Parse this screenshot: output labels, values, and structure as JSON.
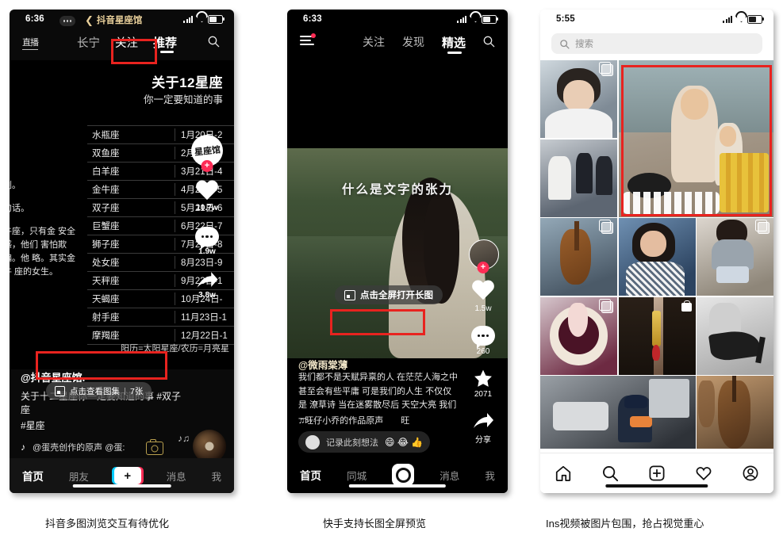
{
  "captions": {
    "phone1": "抖音多图浏览交互有待优化",
    "phone2": "快手支持长图全屏预览",
    "phone3": "Ins视频被图片包围，抢占视觉重心"
  },
  "phone1": {
    "app": "抖音",
    "status": {
      "time": "6:36"
    },
    "nav_title": "抖音星座馆",
    "back_chevron": "❮",
    "tabs": {
      "live": "直播",
      "items": [
        "长宁",
        "关注",
        "推荐"
      ],
      "active": "推荐",
      "highlighted": "关注"
    },
    "search_icon": "search-icon",
    "poster": {
      "title": "关于12星座",
      "subtitle": "你一定要知道的事",
      "rows": [
        {
          "sign": "水瓶座",
          "dates": "1月20日-2"
        },
        {
          "sign": "双鱼座",
          "dates": "2月19日-3"
        },
        {
          "sign": "白羊座",
          "dates": "3月21日-4"
        },
        {
          "sign": "金牛座",
          "dates": "4月20日-5"
        },
        {
          "sign": "双子座",
          "dates": "5月21日-6"
        },
        {
          "sign": "巨蟹座",
          "dates": "6月22日-7"
        },
        {
          "sign": "狮子座",
          "dates": "7月23日-8"
        },
        {
          "sign": "处女座",
          "dates": "8月23日-9"
        },
        {
          "sign": "天秤座",
          "dates": "9月23日-1"
        },
        {
          "sign": "天蝎座",
          "dates": "10月24日-"
        },
        {
          "sign": "射手座",
          "dates": "11月23日-1"
        },
        {
          "sign": "摩羯座",
          "dates": "12月22日-1"
        }
      ],
      "left_text_1": "剧。",
      "left_text_2": "句话。",
      "left_text_3": "牛座，只有金 安全感，他们 害怕欺骗。他 略。其实金牛 座的女生。",
      "footnote": "阳历=太阳星座/农历=月亮星"
    },
    "rail": {
      "avatar_label": "星座馆",
      "follow_plus": "+",
      "like_count": "10.7w",
      "comment_count": "1.9w",
      "share_count": "3.8w"
    },
    "gallery_chip": {
      "label": "点击查看图集",
      "count": "7张",
      "icon": "image-stack-icon"
    },
    "caption": {
      "user": "@抖音星座馆.",
      "desc_line1": "关于十二星座你一定要知道的事 #双子座",
      "desc_line2": "#星座",
      "music_note": "♪",
      "music_text": "@蛋壳创作的原声      @蛋:"
    },
    "bottom_nav": {
      "items": [
        "首页",
        "朋友",
        "消息",
        "我"
      ],
      "active": "首页",
      "plus": "+"
    }
  },
  "phone2": {
    "app": "快手",
    "status": {
      "time": "6:33"
    },
    "menu_icon": "hamburger-icon",
    "tabs": {
      "items": [
        "关注",
        "发现",
        "精选"
      ],
      "active": "精选"
    },
    "search_icon": "search-icon",
    "video": {
      "overlay_title": "什么是文字的张力"
    },
    "chip": {
      "label": "点击全屏打开长图",
      "icon": "long-image-icon"
    },
    "author": "@微雨棠薄",
    "desc": "我们都不是天赋异禀的人 在茫茫人海之中 甚至会有些平庸 可是我们的人生 不仅仅是 潦草诗 当在迷雾散尽后 天空大亮 我们一…",
    "sound": "♫旺仔小乔的作品原声　　旺",
    "comment": {
      "placeholder": "记录此刻想法",
      "emojis": "😄 😂 👍"
    },
    "rail": {
      "follow_plus": "+",
      "like_count": "1.5w",
      "comment_count": "260",
      "star_count": "2071",
      "share_label": "分享"
    },
    "bottom_nav": {
      "items": [
        "首页",
        "同城",
        "消息",
        "我"
      ],
      "active": "首页",
      "record_icon": "record-button-icon"
    }
  },
  "phone3": {
    "app": "Instagram",
    "status": {
      "time": "5:55"
    },
    "search": {
      "placeholder": "搜索",
      "icon": "search-icon"
    },
    "grid": {
      "cells": [
        {
          "name": "portrait-young-man",
          "badge": "reels",
          "g1": "#c9d2d8",
          "g2": "#8b97a1"
        },
        {
          "name": "cooking-video-big",
          "badge": "none",
          "g1": "#c8b9a2",
          "g2": "#7d6d58",
          "big": true
        },
        {
          "name": "group-sitting",
          "badge": "none",
          "g1": "#b7bcc2",
          "g2": "#5f6671"
        },
        {
          "name": "workshop-tools",
          "badge": "reels",
          "g1": "#8fa5b5",
          "g2": "#4d5b68"
        },
        {
          "name": "smiling-woman-blue",
          "badge": "none",
          "g1": "#6f8fb0",
          "g2": "#2f4763"
        },
        {
          "name": "woman-denim-shorts",
          "badge": "reels",
          "g1": "#cfc7bf",
          "g2": "#8d8579"
        },
        {
          "name": "dessert-pour",
          "badge": "reels",
          "g1": "#d8c8cd",
          "g2": "#5d2237"
        },
        {
          "name": "gold-earring-hair",
          "badge": "bag",
          "g1": "#cbb39e",
          "g2": "#6b513e"
        },
        {
          "name": "high-heel-shoe",
          "badge": "none",
          "g1": "#dcdcdc",
          "g2": "#9a9a9a"
        },
        {
          "name": "cctv-counter-clip",
          "badge": "none",
          "g1": "#8f9398",
          "g2": "#30343a",
          "span2": true
        },
        {
          "name": "cello-in-store",
          "badge": "none",
          "g1": "#b08f6b",
          "g2": "#5b4530"
        }
      ]
    },
    "bottom_nav": {
      "items": [
        "home-icon",
        "search-icon",
        "add-post-icon",
        "activity-heart-icon",
        "profile-icon"
      ]
    }
  },
  "annotations": {
    "accent_color": "#e8231f",
    "boxes": [
      {
        "name": "douyin-guanzhu-tab-highlight"
      },
      {
        "name": "douyin-gallery-chip-highlight"
      },
      {
        "name": "kuaishou-longimage-chip-highlight"
      },
      {
        "name": "instagram-video-cell-highlight"
      }
    ]
  }
}
